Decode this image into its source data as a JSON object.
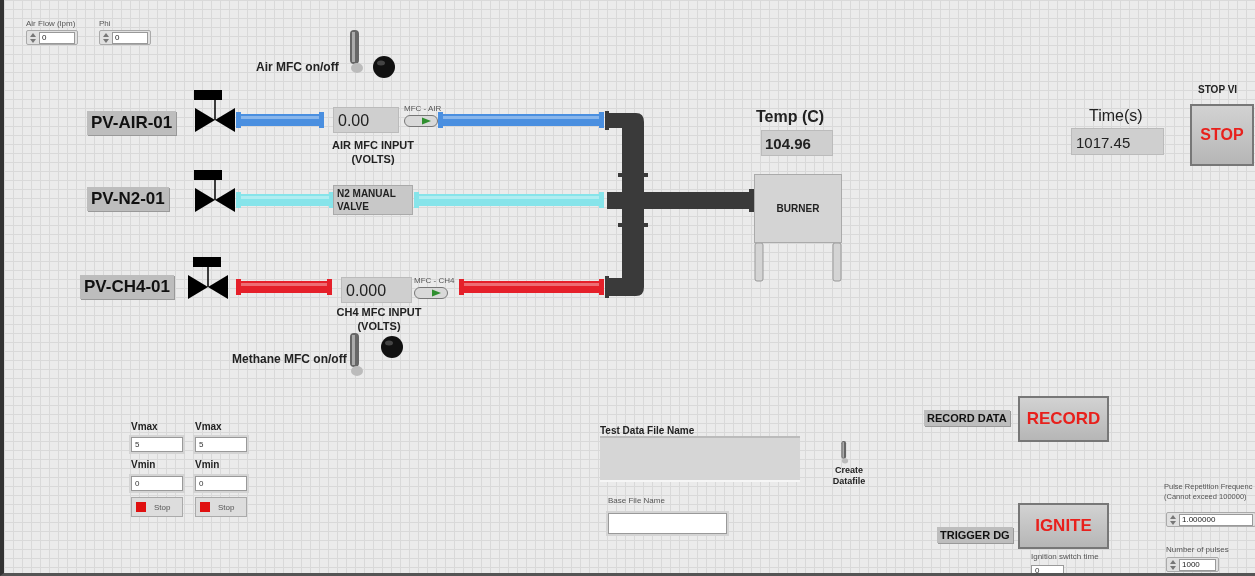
{
  "numeric_controls": [
    {
      "label": "Air Flow (lpm)",
      "value": "0"
    },
    {
      "label": "Phi",
      "value": "0"
    }
  ],
  "toggles": [
    {
      "label": "Air MFC on/off",
      "on": false
    },
    {
      "label": "Methane MFC on/off",
      "on": false
    }
  ],
  "lines": [
    {
      "kind": "mfc",
      "tag": "PV-AIR-01",
      "color": "#4a8fe0",
      "reading": "0.00",
      "switch_label": "MFC - AIR",
      "caption": "AIR MFC INPUT (VOLTS)"
    },
    {
      "kind": "manual",
      "tag": "PV-N2-01",
      "color": "#86e4ea",
      "valve_label": "N2 MANUAL VALVE"
    },
    {
      "kind": "mfc",
      "tag": "PV-CH4-01",
      "color": "#e5202a",
      "reading": "0.000",
      "switch_label": "MFC - CH4",
      "caption": "CH4 MFC INPUT (VOLTS)"
    }
  ],
  "temperature": {
    "label": "Temp (C)",
    "value": "104.96"
  },
  "burner": {
    "label": "BURNER"
  },
  "time": {
    "label": "Time(s)",
    "value": "1017.45"
  },
  "stop": {
    "label": "STOP VI",
    "button": "STOP"
  },
  "limits": [
    {
      "vmax_label": "Vmax",
      "vmax": "5",
      "vmin_label": "Vmin",
      "vmin": "0",
      "stop": "Stop"
    },
    {
      "vmax_label": "Vmax",
      "vmax": "5",
      "vmin_label": "Vmin",
      "vmin": "0",
      "stop": "Stop"
    }
  ],
  "test_file": {
    "label": "Test Data File Name"
  },
  "create_datafile": {
    "label": "Create Datafile",
    "on": false
  },
  "base_file": {
    "label": "Base File Name"
  },
  "record": {
    "label": "RECORD DATA",
    "button": "RECORD"
  },
  "ignite": {
    "label": "TRIGGER DG",
    "button": "IGNITE"
  },
  "ignition_time": {
    "label": "Ignition switch time",
    "value": "0"
  },
  "pulse_frequency": {
    "label_lines": [
      "Pulse Repetition Frequenc",
      "(Cannot exceed 100000)"
    ],
    "value": "1.000000"
  },
  "pulse_count": {
    "label": "Number of pulses",
    "value": "1000"
  }
}
